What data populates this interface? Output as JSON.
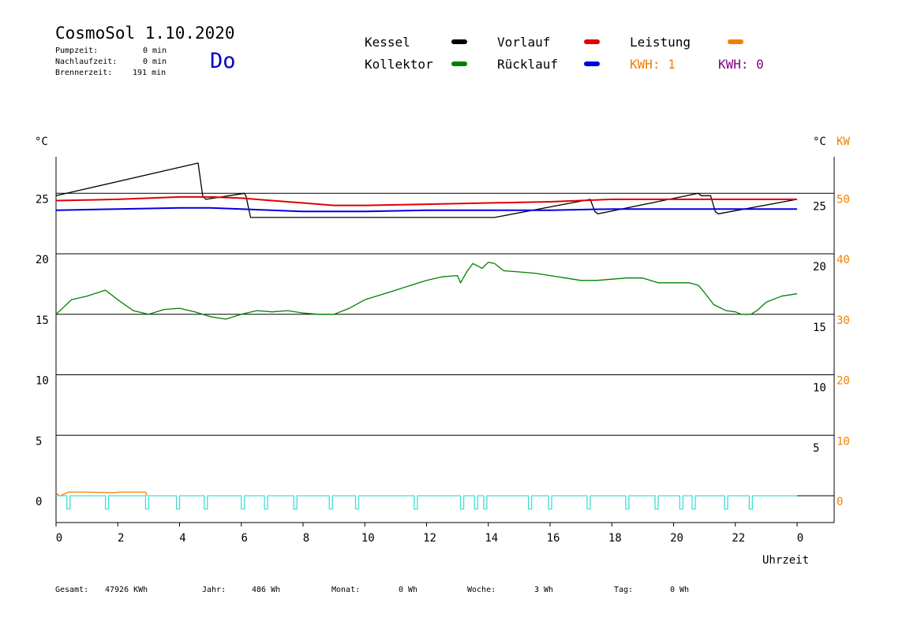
{
  "header": {
    "title": "CosmoSol 1.10.2020",
    "weekday": "Do",
    "stats": [
      {
        "label": "Pumpzeit:",
        "value": "0 min"
      },
      {
        "label": "Nachlaufzeit:",
        "value": "0 min"
      },
      {
        "label": "Brennerzeit:",
        "value": "191 min"
      }
    ]
  },
  "legend": {
    "items": [
      {
        "label": "Kessel",
        "color": "#000000"
      },
      {
        "label": "Vorlauf",
        "color": "#e00000"
      },
      {
        "label": "Leistung",
        "color": "#f08000"
      },
      {
        "label": "Kollektor",
        "color": "#008000"
      },
      {
        "label": "Rücklauf",
        "color": "#0000e0"
      }
    ],
    "kwh": [
      {
        "label": "KWH: 1",
        "color": "#f08000"
      },
      {
        "label": "KWH: 0",
        "color": "#800080"
      }
    ]
  },
  "footer": [
    {
      "label": "Gesamt:",
      "value": "47926 KWh"
    },
    {
      "label": "Jahr:",
      "value": "486 Wh"
    },
    {
      "label": "Monat:",
      "value": "0 Wh"
    },
    {
      "label": "Woche:",
      "value": "3 Wh"
    },
    {
      "label": "Tag:",
      "value": "0 Wh"
    }
  ],
  "chart_data": {
    "type": "line",
    "xlabel": "Uhrzeit",
    "ylabel_left": "°C",
    "ylabel_right": "°C",
    "ylabel_right2": "KW",
    "x_ticks": [
      "0",
      "2",
      "4",
      "6",
      "8",
      "10",
      "12",
      "14",
      "16",
      "18",
      "20",
      "22",
      "0"
    ],
    "xlim": [
      0,
      24
    ],
    "left_axis": {
      "ticks": [
        0,
        5,
        10,
        15,
        20,
        25
      ],
      "ylim": [
        -1.5,
        28.3
      ]
    },
    "right_axis_upper": {
      "label": "°C",
      "ticks": [
        25,
        20
      ],
      "ylim": [
        12,
        28
      ]
    },
    "right_axis_lower": {
      "label": "°C",
      "ticks": [
        15,
        10,
        5
      ]
    },
    "right_axis_kw": {
      "label": "KW",
      "ticks": [
        0,
        10,
        20,
        30,
        40,
        50
      ]
    },
    "colors": {
      "Kessel": "#000000",
      "Vorlauf": "#e00000",
      "Rücklauf": "#0000e0",
      "Kollektor": "#008000",
      "Leistung": "#f08000",
      "Pumpe": "#40e0d0"
    },
    "series": [
      {
        "name": "Kessel",
        "axis": "upper_right",
        "x": [
          0,
          4.6,
          4.75,
          4.85,
          6.1,
          6.15,
          6.3,
          14.2,
          17.3,
          17.45,
          17.55,
          20.8,
          20.9,
          21.2,
          21.35,
          21.45,
          24
        ],
        "y": [
          24.8,
          27.5,
          24.8,
          24.5,
          25.0,
          24.8,
          23.0,
          23.0,
          24.5,
          23.5,
          23.3,
          25.0,
          24.8,
          24.8,
          23.5,
          23.3,
          24.5
        ]
      },
      {
        "name": "Vorlauf",
        "axis": "upper_right",
        "x": [
          0,
          2,
          4,
          5,
          6,
          7,
          8,
          9,
          10,
          12,
          14,
          16,
          18,
          20,
          22,
          24
        ],
        "y": [
          24.4,
          24.5,
          24.7,
          24.7,
          24.6,
          24.4,
          24.2,
          24.0,
          24.0,
          24.1,
          24.2,
          24.3,
          24.5,
          24.5,
          24.5,
          24.5
        ]
      },
      {
        "name": "Rücklauf",
        "axis": "upper_right",
        "x": [
          0,
          2,
          4,
          5,
          6,
          8,
          10,
          12,
          14,
          16,
          18,
          20,
          22,
          24
        ],
        "y": [
          23.6,
          23.7,
          23.8,
          23.8,
          23.7,
          23.5,
          23.5,
          23.6,
          23.6,
          23.6,
          23.7,
          23.7,
          23.7,
          23.7
        ]
      },
      {
        "name": "Kollektor",
        "axis": "left",
        "x": [
          0,
          0.5,
          1,
          1.6,
          2,
          2.5,
          3,
          3.5,
          4,
          4.5,
          5,
          5.5,
          6,
          6.5,
          7,
          7.5,
          8,
          8.5,
          9,
          9.5,
          10,
          10.5,
          11,
          11.5,
          12,
          12.5,
          13,
          13.1,
          13.3,
          13.5,
          13.8,
          14,
          14.2,
          14.5,
          15,
          15.5,
          16,
          16.5,
          17,
          17.5,
          18,
          18.5,
          19,
          19.5,
          20,
          20.5,
          20.8,
          21,
          21.3,
          21.7,
          22,
          22.2,
          22.5,
          22.7,
          23,
          23.5,
          24
        ],
        "y": [
          15.0,
          16.2,
          16.5,
          17.0,
          16.2,
          15.3,
          15.0,
          15.4,
          15.5,
          15.2,
          14.8,
          14.6,
          15.0,
          15.3,
          15.2,
          15.3,
          15.1,
          15.0,
          15.0,
          15.5,
          16.2,
          16.6,
          17.0,
          17.4,
          17.8,
          18.1,
          18.2,
          17.6,
          18.5,
          19.2,
          18.8,
          19.3,
          19.2,
          18.6,
          18.5,
          18.4,
          18.2,
          18.0,
          17.8,
          17.8,
          17.9,
          18.0,
          18.0,
          17.6,
          17.6,
          17.6,
          17.4,
          16.8,
          15.8,
          15.3,
          15.2,
          15.0,
          15.0,
          15.3,
          16.0,
          16.5,
          16.7
        ]
      },
      {
        "name": "Leistung",
        "axis": "kw",
        "x": [
          0,
          0.1,
          0.15,
          0.4,
          1,
          1.9,
          2.0,
          2.2,
          2.9,
          2.95
        ],
        "y": [
          0.5,
          0,
          0,
          0.6,
          0.6,
          0.5,
          0.6,
          0.6,
          0.6,
          0
        ]
      },
      {
        "name": "Pumpe",
        "axis": "left",
        "baseline": 0.0,
        "pulse_depth": 1.1,
        "pulse_starts": [
          0.35,
          1.6,
          2.9,
          3.9,
          4.8,
          6.0,
          6.75,
          7.7,
          8.85,
          9.7,
          11.6,
          13.1,
          13.55,
          13.85,
          15.3,
          15.95,
          17.2,
          18.45,
          19.4,
          20.2,
          20.6,
          21.65,
          22.45
        ]
      }
    ]
  }
}
